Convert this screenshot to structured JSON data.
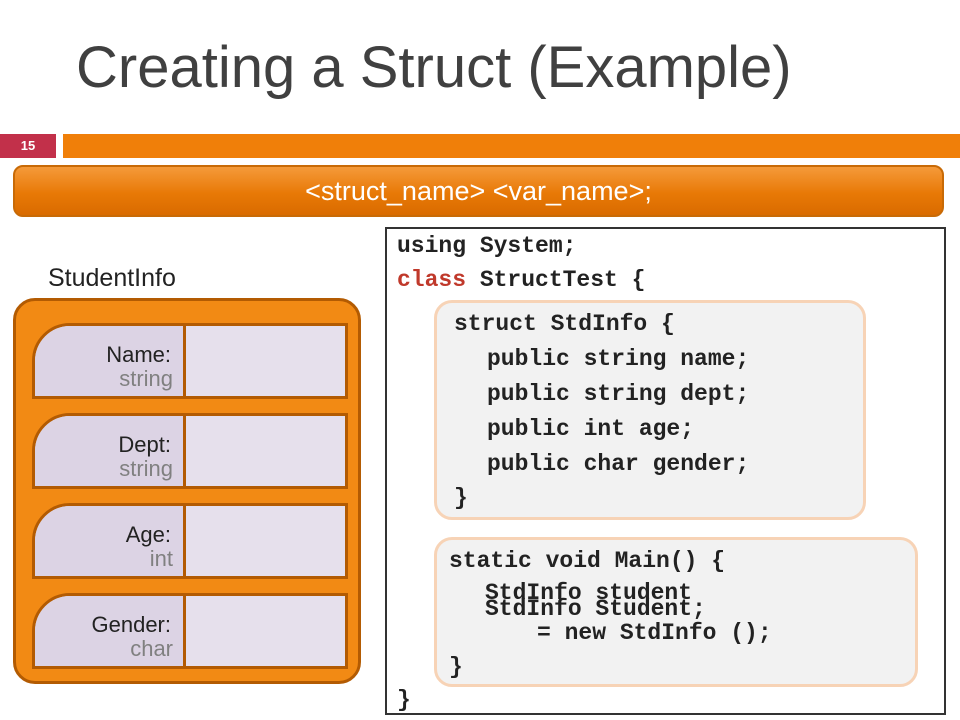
{
  "slide": {
    "title": "Creating a Struct (Example)",
    "number": "15",
    "syntax": "<struct_name> <var_name>;"
  },
  "diagram": {
    "label": "StudentInfo",
    "fields": [
      {
        "name": "Name:",
        "type": "string"
      },
      {
        "name": "Dept:",
        "type": "string"
      },
      {
        "name": "Age:",
        "type": "int"
      },
      {
        "name": "Gender:",
        "type": "char"
      }
    ]
  },
  "code": {
    "line_using": "using System;",
    "kw_class": "class",
    "line_class_rest": " StructTest {",
    "struct_decl": "struct StdInfo {",
    "member_1": "public string name;",
    "member_2": "public string dept;",
    "member_3": "public int age;",
    "member_4": "public char gender;",
    "struct_close": "}",
    "main_decl": "static void Main() {",
    "stmt_a": "StdInfo student",
    "stmt_b": "StdInfo Student;",
    "stmt_c": "= new StdInfo ();",
    "main_close": "}",
    "class_close": "}"
  },
  "colors": {
    "accent_orange": "#f07f09",
    "slide_number_red": "#c2304a",
    "keyword_red": "#c0392b"
  }
}
